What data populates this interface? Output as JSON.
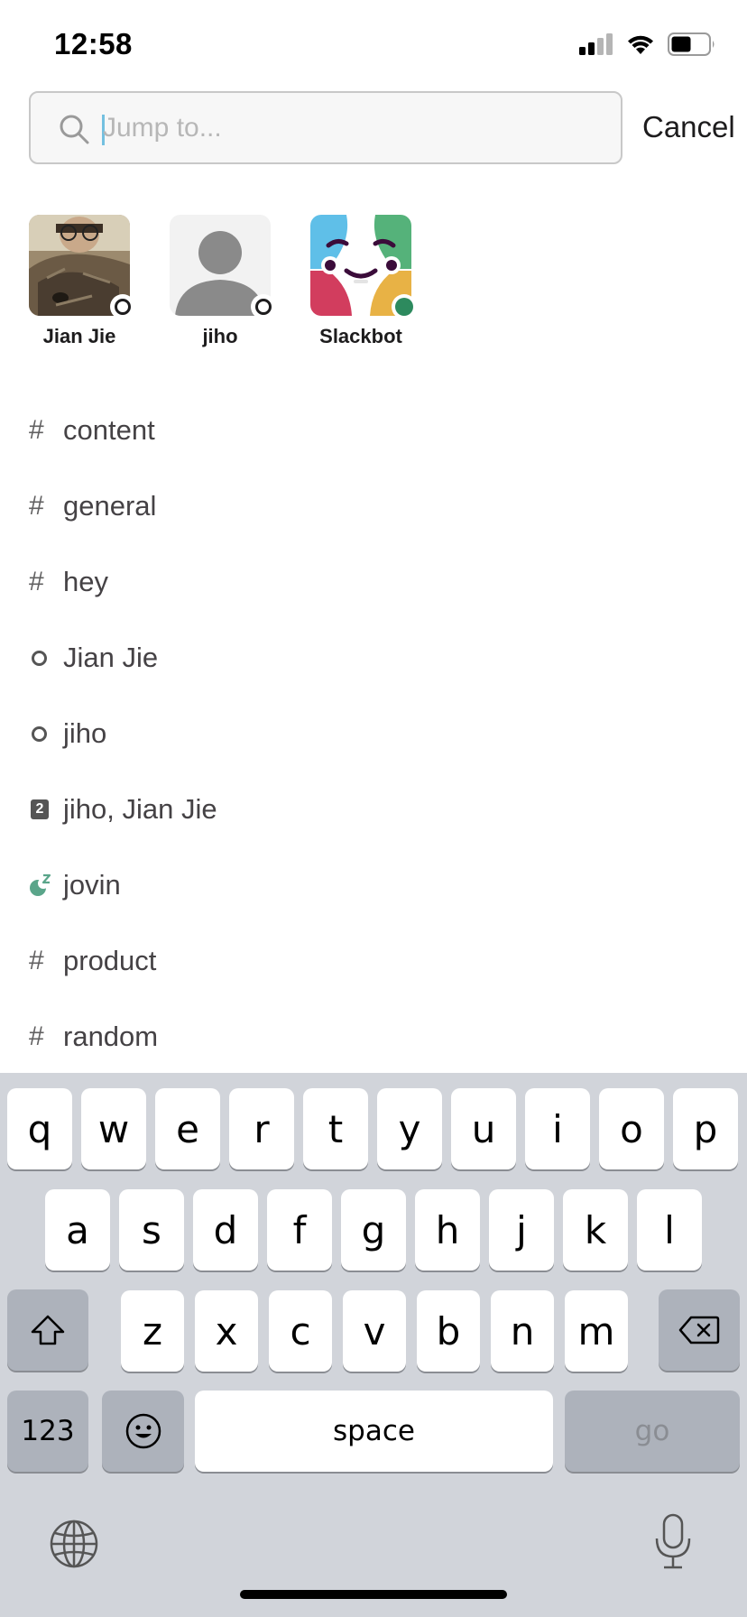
{
  "status_bar": {
    "time": "12:58",
    "icons": [
      "cellular-signal-icon",
      "wifi-icon",
      "battery-icon"
    ]
  },
  "search": {
    "placeholder": "Jump to...",
    "value": "",
    "cancel_label": "Cancel"
  },
  "recent_avatars": [
    {
      "name": "Jian Jie",
      "presence": "away",
      "avatar": "photo-cat-icon"
    },
    {
      "name": "jiho",
      "presence": "away",
      "avatar": "default-user-icon"
    },
    {
      "name": "Slackbot",
      "presence": "active",
      "avatar": "slackbot-icon"
    }
  ],
  "channels": [
    {
      "icon": "hash-icon",
      "label": "content"
    },
    {
      "icon": "hash-icon",
      "label": "general"
    },
    {
      "icon": "hash-icon",
      "label": "hey"
    },
    {
      "icon": "away-presence-icon",
      "label": "Jian Jie"
    },
    {
      "icon": "away-presence-icon",
      "label": "jiho"
    },
    {
      "icon": "group-dm-2-icon",
      "label": "jiho, Jian Jie",
      "badge": "2"
    },
    {
      "icon": "snooze-presence-icon",
      "label": "jovin"
    },
    {
      "icon": "hash-icon",
      "label": "product"
    },
    {
      "icon": "hash-icon",
      "label": "random"
    }
  ],
  "keyboard": {
    "row1": [
      "q",
      "w",
      "e",
      "r",
      "t",
      "y",
      "u",
      "i",
      "o",
      "p"
    ],
    "row2": [
      "a",
      "s",
      "d",
      "f",
      "g",
      "h",
      "j",
      "k",
      "l"
    ],
    "row3": [
      "z",
      "x",
      "c",
      "v",
      "b",
      "n",
      "m"
    ],
    "numbers_label": "123",
    "space_label": "space",
    "go_label": "go",
    "icons": [
      "shift-icon",
      "backspace-icon",
      "emoji-icon",
      "globe-icon",
      "microphone-icon"
    ]
  },
  "colors": {
    "active_presence": "#2d8a5e",
    "keyboard_bg": "#d1d4da",
    "cursor": "#1d9bd1"
  }
}
